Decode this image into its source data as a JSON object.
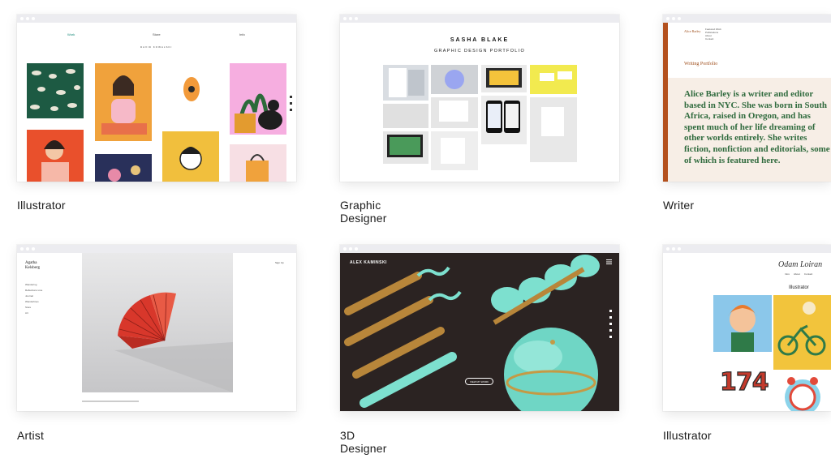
{
  "cards": [
    {
      "label": "Illustrator",
      "nav": [
        "Work",
        "Store",
        "Info"
      ],
      "subtitle": "DAVID KOWALSKI"
    },
    {
      "label": "Graphic Designer",
      "name": "SASHA BLAKE",
      "subtitle": "GRAPHIC DESIGN PORTFOLIO"
    },
    {
      "label": "Writer",
      "author": "Alice Barley",
      "menu": [
        "Featured Work",
        "Publications",
        "About",
        "Contact"
      ],
      "section": "Writing Portfolio",
      "bio": "Alice Barley is a writer and editor based in NYC. She was born in South Africa, raised in Oregon, and has spent much of her life dreaming of other worlds entirely. She writes fiction, nonfiction and editorials, some of which is featured here."
    },
    {
      "label": "Artist",
      "name": "Agatha Kelsberg",
      "menu": [
        "Wandering",
        "Reflections Line",
        "Journal",
        "Wanderlines",
        "Store",
        "Art"
      ],
      "top_link": "Sign Up"
    },
    {
      "label": "3D Designer",
      "name": "ALEX KAMINSKI",
      "button": "VIEW MY WORK"
    },
    {
      "label": "Illustrator",
      "name": "Odam Loiran",
      "nav": [
        "Intro",
        "About",
        "Contact"
      ],
      "section": "Illustrator",
      "number": "174"
    }
  ]
}
